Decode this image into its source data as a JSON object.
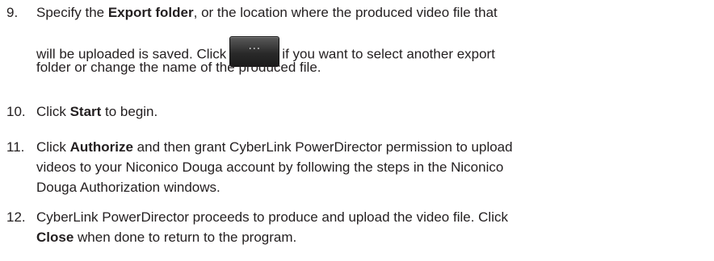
{
  "steps": [
    {
      "number": "9.",
      "line1_pre": "Specify the ",
      "line1_bold": "Export folder",
      "line1_post": ", or the location where the produced video file that",
      "line2_pre": "will be uploaded is saved. Click",
      "line2_post": "if you want to select another export",
      "line3": "folder or change the name of the produced file.",
      "button_icon": "ellipsis-button-icon",
      "button_glyph": "···"
    },
    {
      "number": "10.",
      "pre": "Click ",
      "bold": "Start",
      "post": " to begin."
    },
    {
      "number": "11.",
      "line1_pre": "Click ",
      "line1_bold": "Authorize",
      "line1_post": " and then grant CyberLink PowerDirector permission to upload",
      "line2": "videos to your Niconico Douga account by following the steps in the Niconico",
      "line3": "Douga Authorization windows."
    },
    {
      "number": "12.",
      "line1": "CyberLink PowerDirector proceeds to produce and upload the video file. Click",
      "line2_bold": "Close",
      "line2_post": " when done to return to the program."
    }
  ]
}
